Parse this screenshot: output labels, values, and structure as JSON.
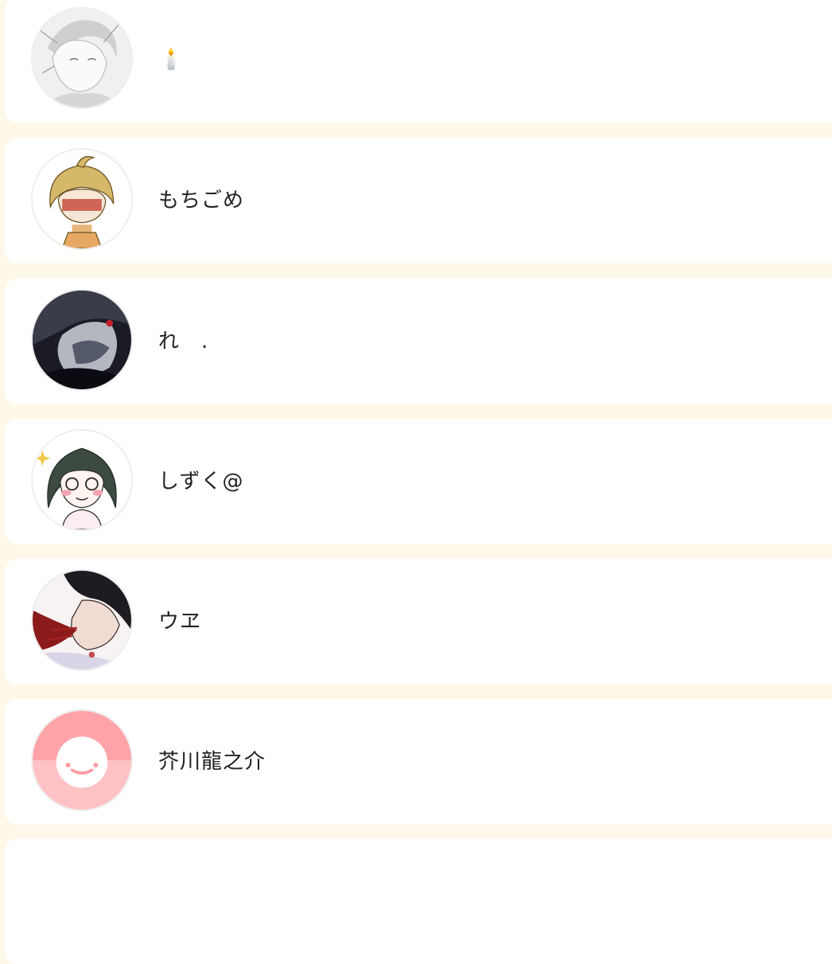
{
  "users": [
    {
      "name": "🕯️",
      "avatar": "sketch-portrait-avatar"
    },
    {
      "name": "もちごめ",
      "avatar": "blonde-character-avatar"
    },
    {
      "name": "れ　.",
      "avatar": "dark-portrait-avatar"
    },
    {
      "name": "しずく@",
      "avatar": "green-hair-girl-avatar"
    },
    {
      "name": "ウヱ",
      "avatar": "dark-hair-character-avatar"
    },
    {
      "name": "芥川龍之介",
      "avatar": "default-smile-avatar"
    }
  ],
  "colors": {
    "page_background": "#fdf8e8",
    "card_background": "#ffffff",
    "default_avatar_top": "#ffa3a8",
    "default_avatar_bottom": "#ffc2c4"
  }
}
